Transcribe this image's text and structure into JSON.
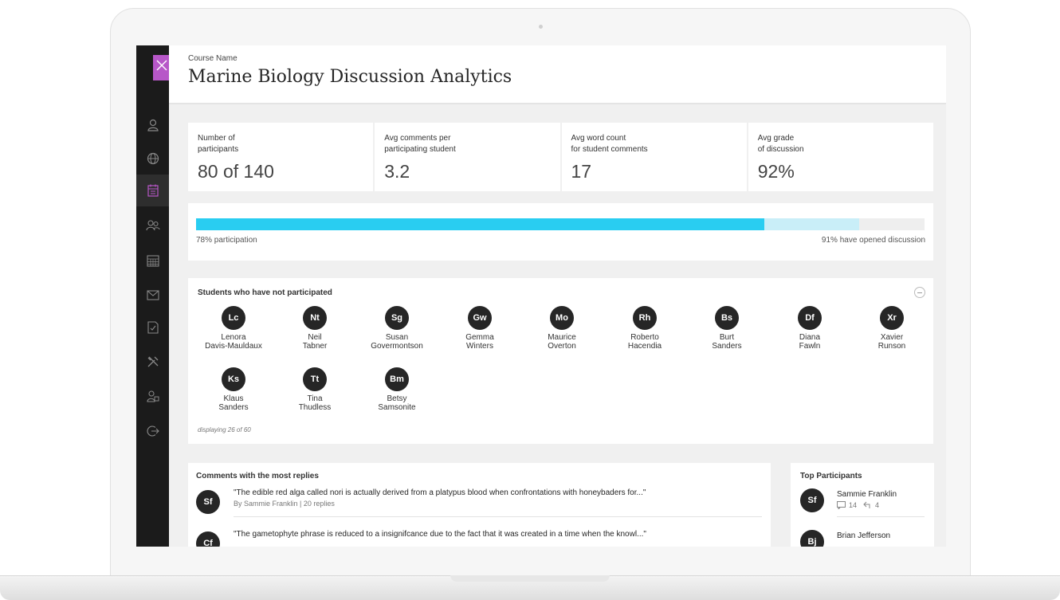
{
  "colors": {
    "accent": "#29cdf1",
    "accent_light": "#c9eef8",
    "brand": "#b757c8",
    "sidebar": "#1b1b1b",
    "avatar": "#262626"
  },
  "header": {
    "course_label": "Course Name",
    "title": "Marine Biology Discussion Analytics"
  },
  "sidebar": {
    "items": [
      {
        "icon": "user-icon"
      },
      {
        "icon": "globe-icon"
      },
      {
        "icon": "calendar-icon",
        "active": true
      },
      {
        "icon": "people-icon"
      },
      {
        "icon": "grid-calendar-icon"
      },
      {
        "icon": "mail-icon"
      },
      {
        "icon": "grades-icon"
      },
      {
        "icon": "tools-icon"
      },
      {
        "icon": "lock-icon"
      },
      {
        "icon": "logout-icon"
      }
    ]
  },
  "stats": [
    {
      "label": "Number of\nparticipants",
      "value": "80 of 140"
    },
    {
      "label": "Avg comments per\nparticipating student",
      "value": "3.2"
    },
    {
      "label": "Avg word count\nfor student comments",
      "value": "17"
    },
    {
      "label": "Avg grade\nof discussion",
      "value": "92%"
    }
  ],
  "participation": {
    "participated_fraction": 0.78,
    "opened_fraction": 0.91,
    "left_label": "78% participation",
    "right_label": "91% have opened discussion"
  },
  "not_participated": {
    "title": "Students who have not participated",
    "students": [
      {
        "initials": "Lc",
        "name": "Lenora\nDavis-Mauldaux"
      },
      {
        "initials": "Nt",
        "name": "Neil\nTabner"
      },
      {
        "initials": "Sg",
        "name": "Susan\nGovermontson"
      },
      {
        "initials": "Gw",
        "name": "Gemma\nWinters"
      },
      {
        "initials": "Mo",
        "name": "Maurice\nOverton"
      },
      {
        "initials": "Rh",
        "name": "Roberto\nHacendia"
      },
      {
        "initials": "Bs",
        "name": "Burt\nSanders"
      },
      {
        "initials": "Df",
        "name": "Diana\nFawln"
      },
      {
        "initials": "Xr",
        "name": "Xavier\nRunson"
      },
      {
        "initials": "Ks",
        "name": "Klaus\nSanders"
      },
      {
        "initials": "Tt",
        "name": "Tina\nThudless"
      },
      {
        "initials": "Bm",
        "name": "Betsy\nSamsonite"
      }
    ],
    "displaying": "displaying 26 of 60"
  },
  "replies": {
    "title": "Comments with the most replies",
    "comments": [
      {
        "initials": "Sf",
        "text": "\"The edible red alga called nori is actually derived from a platypus blood when confrontations with honeybaders for...\"",
        "meta": "By Sammie Franklin | 20 replies"
      },
      {
        "initials": "Cf",
        "text": "\"The gametophyte phrase is reduced to a insignifcance due to the fact that it was created in a time when the knowl...\"",
        "meta": ""
      }
    ]
  },
  "top_participants": {
    "title": "Top Participants",
    "people": [
      {
        "initials": "Sf",
        "name": "Sammie Franklin",
        "comments": "14",
        "replies": "4"
      },
      {
        "initials": "Bj",
        "name": "Brian Jefferson",
        "comments": "",
        "replies": ""
      }
    ]
  }
}
